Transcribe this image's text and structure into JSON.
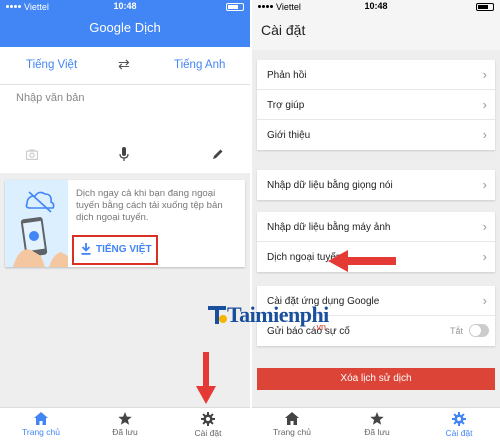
{
  "left": {
    "status": {
      "carrier": "Viettel",
      "time": "10:48"
    },
    "app_title": "Google Dịch",
    "lang_from": "Tiếng Việt",
    "lang_to": "Tiếng Anh",
    "input_placeholder": "Nhập văn bản",
    "offline_card": {
      "message": "Dịch ngay cả khi bạn đang ngoại tuyến bằng cách tải xuống tệp bản dịch ngoại tuyến.",
      "download_label": "TIẾNG VIỆT"
    },
    "tabs": [
      {
        "label": "Trang chủ",
        "icon": "home-icon",
        "active": true
      },
      {
        "label": "Đã lưu",
        "icon": "star-icon",
        "active": false
      },
      {
        "label": "Cài đặt",
        "icon": "gear-icon",
        "active": false
      }
    ]
  },
  "right": {
    "status": {
      "carrier": "Viettel",
      "time": "10:48"
    },
    "title": "Cài đặt",
    "groups": [
      {
        "rows": [
          {
            "label": "Phản hồi"
          },
          {
            "label": "Trợ giúp"
          },
          {
            "label": "Giới thiệu"
          }
        ]
      },
      {
        "rows": [
          {
            "label": "Nhập dữ liệu bằng giọng nói"
          }
        ]
      },
      {
        "rows": [
          {
            "label": "Nhập dữ liệu bằng máy ảnh"
          },
          {
            "label": "Dịch ngoại tuyến"
          }
        ]
      },
      {
        "rows": [
          {
            "label": "Cài đặt ứng dụng Google"
          },
          {
            "label": "Gửi báo cáo sự cố",
            "value": "Tắt"
          }
        ]
      }
    ],
    "clear_history_label": "Xóa lịch sử dịch",
    "tabs": [
      {
        "label": "Trang chủ",
        "icon": "home-icon",
        "active": false
      },
      {
        "label": "Đã lưu",
        "icon": "star-icon",
        "active": false
      },
      {
        "label": "Cài đặt",
        "icon": "gear-icon",
        "active": true
      }
    ]
  },
  "watermark": {
    "brand": "Taimienphi",
    "suffix": ".vn"
  },
  "colors": {
    "google_blue": "#4285f4",
    "highlight_red": "#d93025",
    "danger": "#db4437"
  }
}
